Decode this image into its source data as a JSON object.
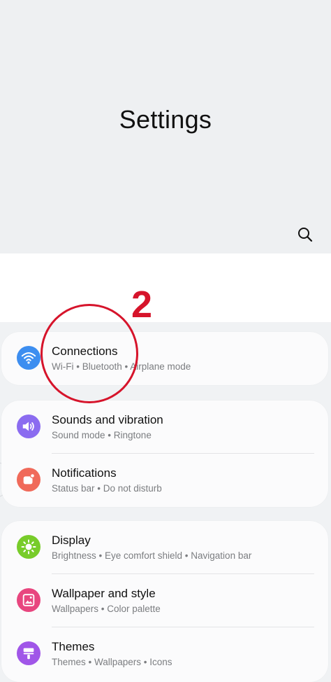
{
  "header": {
    "title": "Settings",
    "search_icon": "search-icon"
  },
  "annotation": {
    "number": "2",
    "color": "#d6142b"
  },
  "settings": [
    {
      "key": "connections",
      "title": "Connections",
      "subtitle": "Wi-Fi  •  Bluetooth  •  Airplane mode",
      "icon": "wifi-icon",
      "color": "#3d8ef0"
    },
    {
      "key": "sounds",
      "title": "Sounds and vibration",
      "subtitle": "Sound mode  •  Ringtone",
      "icon": "speaker-icon",
      "color": "#8b6cf0"
    },
    {
      "key": "notifications",
      "title": "Notifications",
      "subtitle": "Status bar  •  Do not disturb",
      "icon": "notification-icon",
      "color": "#f06a5a"
    },
    {
      "key": "display",
      "title": "Display",
      "subtitle": "Brightness  •  Eye comfort shield  •  Navigation bar",
      "icon": "sun-icon",
      "color": "#78cc2a"
    },
    {
      "key": "wallpaper",
      "title": "Wallpaper and style",
      "subtitle": "Wallpapers  •  Color palette",
      "icon": "wallpaper-icon",
      "color": "#e8467f"
    },
    {
      "key": "themes",
      "title": "Themes",
      "subtitle": "Themes  •  Wallpapers  •  Icons",
      "icon": "themes-icon",
      "color": "#a056e8"
    }
  ]
}
